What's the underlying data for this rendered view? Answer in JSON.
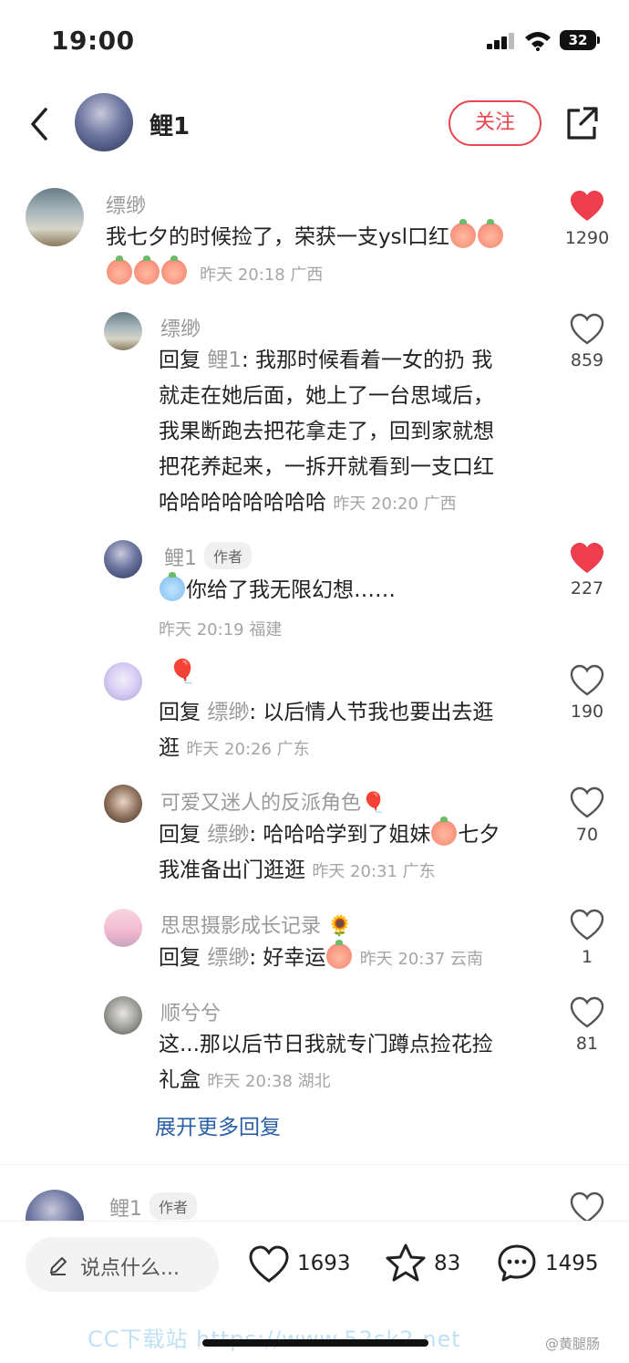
{
  "status": {
    "time": "19:00",
    "battery": "32"
  },
  "header": {
    "name": "鲤1",
    "follow_label": "关注"
  },
  "comments": [
    {
      "name": "缥缈",
      "text": "我七夕的时候捡了，荣获一支ysl口红",
      "time": "昨天 20:18 广西",
      "likes": "1290",
      "liked": true,
      "replies": [
        {
          "name": "缥缈",
          "reply_prefix": "回复",
          "reply_target": "鲤1",
          "line1": "我那时候看着一女的扔  我",
          "line2": "就走在她后面，她上了一台思域后，",
          "line3": "我果断跑去把花拿走了，回到家就想",
          "line4": "把花养起来，一拆开就看到一支口红",
          "line5": "哈哈哈哈哈哈哈哈",
          "time": "昨天 20:20 广西",
          "likes": "859"
        },
        {
          "name": "鲤1",
          "author_tag": "作者",
          "text": "你给了我无限幻想……",
          "time": "昨天 20:19 福建",
          "likes": "227"
        },
        {
          "name_emoji": "🎈",
          "reply_prefix": "回复",
          "reply_target": "缥缈",
          "line1": "以后情人节我也要出去逛",
          "line2": "逛",
          "time": "昨天 20:26 广东",
          "likes": "190"
        },
        {
          "name": "可爱又迷人的反派角色🎈",
          "reply_prefix": "回复",
          "reply_target": "缥缈",
          "line1": "哈哈哈学到了姐妹",
          "line1b": "七夕",
          "line2": "我准备出门逛逛",
          "time": "昨天 20:31 广东",
          "likes": "70"
        },
        {
          "name": "思思摄影成长记录 🌻",
          "reply_prefix": "回复",
          "reply_target": "缥缈",
          "text": "好幸运",
          "time": "昨天 20:37 云南",
          "likes": "1"
        },
        {
          "name": "顺兮兮",
          "line1": "这...那以后节日我就专门蹲点捡花捡",
          "line2": "礼盒",
          "time": "昨天 20:38 湖北",
          "likes": "81"
        }
      ]
    },
    {
      "name": "鲤1",
      "author_tag": "作者"
    }
  ],
  "expand_more": "展开更多回复",
  "bottom_bar": {
    "input_placeholder": "说点什么...",
    "likes": "1693",
    "stars": "83",
    "comments": "1495"
  },
  "watermark": "CC下载站  https://www.52sk2.net",
  "weibo_mark": "@黄腿肠"
}
